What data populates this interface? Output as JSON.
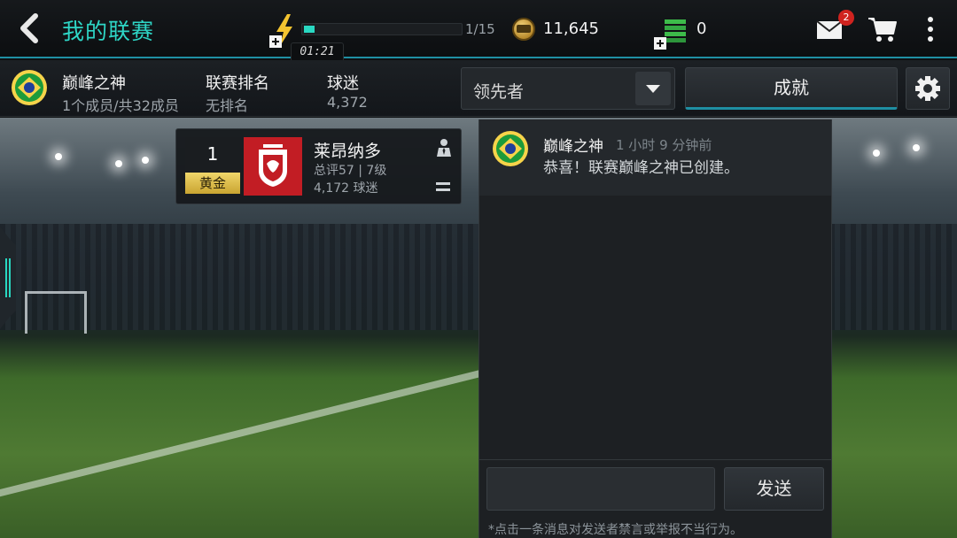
{
  "header": {
    "back_icon": "chevron-left-icon",
    "title": "我的联赛",
    "energy": {
      "icon": "lightning-bolt-icon",
      "current": 1,
      "max": 15,
      "label": "1/15",
      "progress": 0.066,
      "timer": "01:21"
    },
    "coins": {
      "icon": "coin-icon",
      "value": "11,645"
    },
    "cash": {
      "icon": "cash-stack-icon",
      "value": "0"
    },
    "mail": {
      "icon": "envelope-icon",
      "badge": "2"
    },
    "cart_icon": "shopping-cart-icon",
    "more_icon": "more-vertical-icon"
  },
  "league": {
    "badge_icon": "brazil-flag-badge-icon",
    "name": "巅峰之神",
    "members": "1个成员/共32成员",
    "rank_label": "联赛排名",
    "rank_value": "无排名",
    "fans_label": "球迷",
    "fans_value": "4,372"
  },
  "controls": {
    "dropdown_selected": "领先者",
    "achievements_label": "成就",
    "settings_icon": "gear-icon"
  },
  "member_card": {
    "rank": "1",
    "tier": "黄金",
    "club_crest_icon": "club-crest-icon",
    "name": "莱昂纳多",
    "rating": "总评57 | 7级",
    "fans": "4,172 球迷",
    "manager_icon": "manager-icon",
    "trend_icon": "equal-icon"
  },
  "chat": {
    "messages": [
      {
        "sender": "巅峰之神",
        "time": "1 小时 9 分钟前",
        "text": "恭喜！联赛巅峰之神已创建。",
        "avatar_icon": "brazil-flag-badge-icon"
      }
    ],
    "input_value": "",
    "send_label": "发送",
    "note": "*点击一条消息对发送者禁言或举报不当行为。"
  },
  "colors": {
    "accent": "#2ed6c6",
    "badge_red": "#d0231f",
    "gold": "#e4c54f",
    "crest_red": "#c21d24"
  }
}
